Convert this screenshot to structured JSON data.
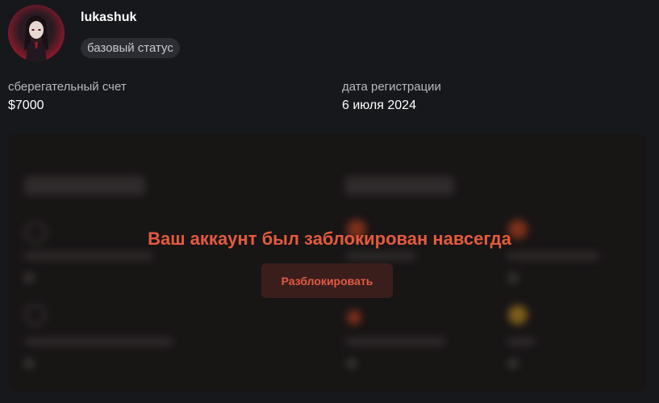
{
  "profile": {
    "username": "lukashuk",
    "status_badge": "базовый статус",
    "avatar_icon": "anime-character-avatar"
  },
  "info": {
    "savings_label": "сберегательный счет",
    "savings_value": "$7000",
    "registration_label": "дата регистрации",
    "registration_value": "6 июля 2024"
  },
  "lock_overlay": {
    "message": "Ваш аккаунт был заблокирован навсегда",
    "unlock_button": "Разблокировать",
    "accent_color": "#e45a3f"
  }
}
